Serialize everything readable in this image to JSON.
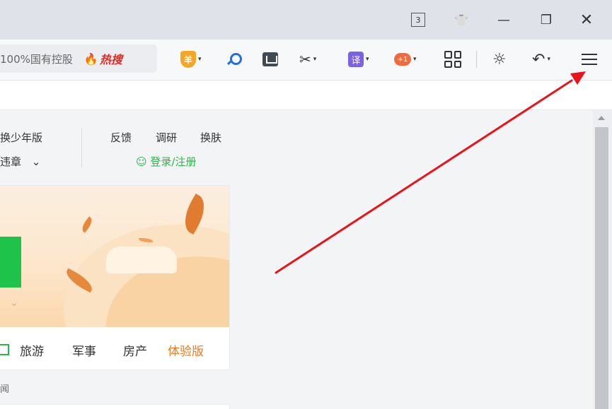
{
  "titlebar": {
    "tab_count": "3",
    "icons": {
      "skin": "tshirt-icon",
      "minimize": "minimize-icon",
      "restore": "restore-icon",
      "close": "close-icon"
    },
    "min_glyph": "—",
    "restore_glyph": "❐",
    "close_glyph": "✕",
    "skin_glyph": "👕"
  },
  "toolbar": {
    "search_text": "100%国有控股",
    "hot_search": "热搜",
    "hot_glyph": "🔥",
    "shield_glyph": "羊",
    "translate_glyph": "译",
    "game_glyph": "+1",
    "scissors_glyph": "✂",
    "sun_glyph": "☼",
    "undo_glyph": "↶",
    "caret": "▾"
  },
  "content": {
    "links": {
      "teen": "换少年版",
      "feedback": "反馈",
      "survey": "调研",
      "skin": "换肤",
      "violation": "违章",
      "violation_caret": "⌄",
      "login": "登录/注册"
    },
    "categories": [
      "旅游",
      "军事",
      "房产"
    ],
    "trial": "体验版",
    "below_text": "闻",
    "chev": "⌄"
  },
  "colors": {
    "accent_green": "#2cb64a",
    "hot_red": "#e02e24",
    "trial_orange": "#f17a1a",
    "arrow_red": "#e8141a"
  }
}
